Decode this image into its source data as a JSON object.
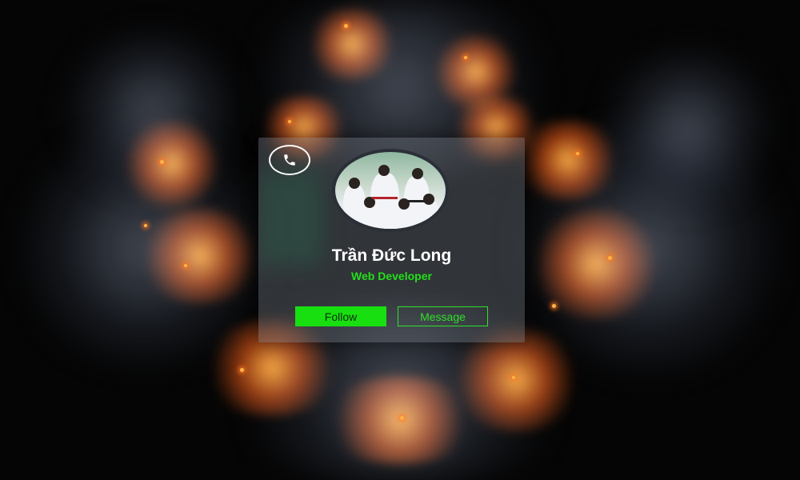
{
  "profile": {
    "name": "Trần Đức Long",
    "role": "Web Developer",
    "avatar_alt": "profile photo"
  },
  "actions": {
    "follow_label": "Follow",
    "message_label": "Message",
    "call_icon": "phone-icon"
  },
  "colors": {
    "accent": "#18e010",
    "role_text": "#22e01a",
    "card_bg": "rgba(120,130,140,0.38)",
    "background": "#050505"
  }
}
